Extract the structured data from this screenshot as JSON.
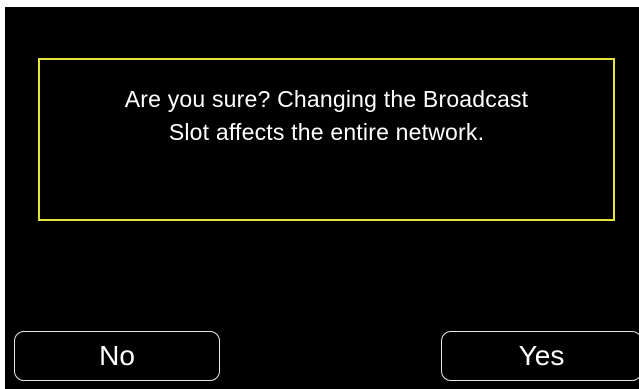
{
  "dialog": {
    "message_line1": "Are you sure? Changing the Broadcast",
    "message_line2": "Slot affects the entire network."
  },
  "buttons": {
    "no_label": "No",
    "yes_label": "Yes"
  },
  "colors": {
    "background": "#000000",
    "border_accent": "#e6e33c",
    "text": "#ffffff",
    "button_border": "#e9e9e9"
  }
}
